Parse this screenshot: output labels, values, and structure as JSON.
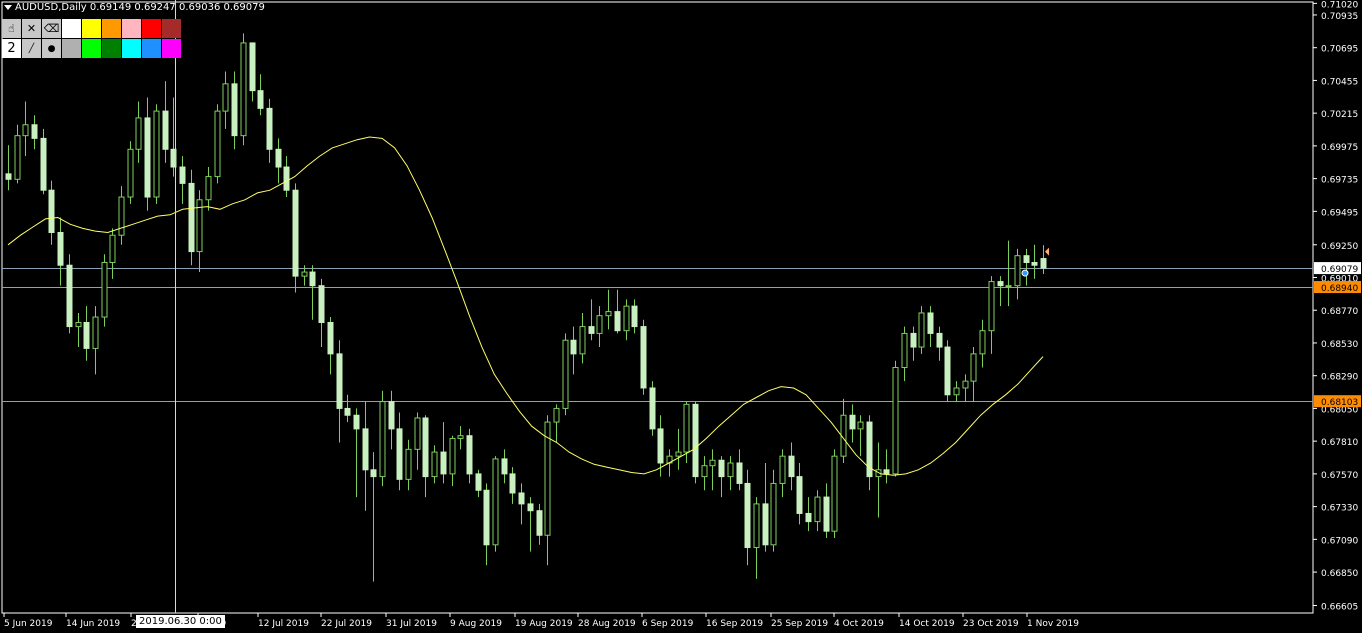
{
  "window": {
    "title": "AUDUSD,Daily  0.69149 0.69247 0.69036 0.69079"
  },
  "toolbar": {
    "tools": [
      "hand-icon",
      "close-x-icon",
      "eraser-icon"
    ],
    "line_width": "2",
    "line_styles": [
      "line-style-icon",
      "dot-style-icon"
    ],
    "colors_row1": [
      "#ffffff",
      "#ffff00",
      "#ff9900",
      "#ffb6c1",
      "#ff0000",
      "#a52a2a"
    ],
    "colors_row2": [
      "#b0b0b0",
      "#00ff00",
      "#008000",
      "#00ffff",
      "#1e90ff",
      "#ff00ff"
    ]
  },
  "crosshair": {
    "date_label": "2019.06.30 0:00"
  },
  "chart_data": {
    "type": "candlestick",
    "symbol": "AUDUSD",
    "timeframe": "Daily",
    "ohlc_header": {
      "open": 0.69149,
      "high": 0.69247,
      "low": 0.69036,
      "close": 0.69079
    },
    "ylim": [
      0.6655,
      0.7103
    ],
    "y_ticks": [
      "0.71020",
      "0.70935",
      "0.70695",
      "0.70455",
      "0.70215",
      "0.69975",
      "0.69735",
      "0.69495",
      "0.69250",
      "0.69010",
      "0.68770",
      "0.68530",
      "0.68290",
      "0.68050",
      "0.67810",
      "0.67570",
      "0.67330",
      "0.67090",
      "0.66850",
      "0.66605"
    ],
    "x_ticks": [
      "5 Jun 2019",
      "14 Jun 2019",
      "2",
      "l 2019",
      "12 Jul 2019",
      "22 Jul 2019",
      "31 Jul 2019",
      "9 Aug 2019",
      "19 Aug 2019",
      "28 Aug 2019",
      "6 Sep 2019",
      "16 Sep 2019",
      "25 Sep 2019",
      "4 Oct 2019",
      "14 Oct 2019",
      "23 Oct 2019",
      "1 Nov 2019"
    ],
    "price_labels": [
      {
        "text": "0.69079",
        "value": 0.69079,
        "color": "#ffffff",
        "bg": "#ffffff"
      },
      {
        "text": "0.68940",
        "value": 0.6894,
        "color": "#000000",
        "bg": "#ff8c00"
      },
      {
        "text": "0.68103",
        "value": 0.68103,
        "color": "#000000",
        "bg": "#ff8c00"
      }
    ],
    "horizontal_lines": [
      {
        "value": 0.69079,
        "color": "#8aa0b8"
      },
      {
        "value": 0.6894,
        "color": "#ff8c00"
      },
      {
        "value": 0.68103,
        "color": "#ff8c00"
      }
    ],
    "candle_color": "#c8f0c0",
    "wick_color": "#7cd05a",
    "ma_color": "#ffff66",
    "candles": [
      [
        0.6977,
        0.6998,
        0.6965,
        0.6973
      ],
      [
        0.6973,
        0.7013,
        0.697,
        0.7005
      ],
      [
        0.7005,
        0.703,
        0.699,
        0.7013
      ],
      [
        0.7013,
        0.702,
        0.6995,
        0.7003
      ],
      [
        0.7003,
        0.701,
        0.6962,
        0.6965
      ],
      [
        0.6965,
        0.6972,
        0.6925,
        0.6934
      ],
      [
        0.6934,
        0.6945,
        0.6895,
        0.691
      ],
      [
        0.691,
        0.6918,
        0.686,
        0.6865
      ],
      [
        0.6865,
        0.6875,
        0.685,
        0.6868
      ],
      [
        0.6868,
        0.688,
        0.684,
        0.6849
      ],
      [
        0.6849,
        0.688,
        0.683,
        0.6872
      ],
      [
        0.6872,
        0.6918,
        0.6865,
        0.6912
      ],
      [
        0.6912,
        0.6937,
        0.69,
        0.6932
      ],
      [
        0.6932,
        0.6968,
        0.6925,
        0.696
      ],
      [
        0.696,
        0.7001,
        0.6955,
        0.6995
      ],
      [
        0.6995,
        0.703,
        0.6985,
        0.7018
      ],
      [
        0.7018,
        0.7033,
        0.695,
        0.696
      ],
      [
        0.696,
        0.7028,
        0.6955,
        0.7023
      ],
      [
        0.7023,
        0.7045,
        0.6985,
        0.6995
      ],
      [
        0.6995,
        0.7033,
        0.6975,
        0.6982
      ],
      [
        0.6982,
        0.699,
        0.6955,
        0.697
      ],
      [
        0.697,
        0.698,
        0.691,
        0.692
      ],
      [
        0.692,
        0.6965,
        0.6905,
        0.6958
      ],
      [
        0.6958,
        0.6982,
        0.695,
        0.6975
      ],
      [
        0.6975,
        0.7028,
        0.697,
        0.7023
      ],
      [
        0.7023,
        0.7052,
        0.701,
        0.7043
      ],
      [
        0.7043,
        0.7052,
        0.6995,
        0.7005
      ],
      [
        0.7005,
        0.708,
        0.6998,
        0.7073
      ],
      [
        0.7073,
        0.7072,
        0.703,
        0.7038
      ],
      [
        0.7038,
        0.705,
        0.702,
        0.7025
      ],
      [
        0.7025,
        0.7032,
        0.6985,
        0.6995
      ],
      [
        0.6995,
        0.7003,
        0.697,
        0.6982
      ],
      [
        0.6982,
        0.699,
        0.696,
        0.6965
      ],
      [
        0.6965,
        0.697,
        0.689,
        0.6902
      ],
      [
        0.6902,
        0.691,
        0.6895,
        0.6905
      ],
      [
        0.6905,
        0.691,
        0.687,
        0.6895
      ],
      [
        0.6895,
        0.69,
        0.685,
        0.6868
      ],
      [
        0.6868,
        0.6872,
        0.683,
        0.6845
      ],
      [
        0.6845,
        0.6855,
        0.678,
        0.6805
      ],
      [
        0.6805,
        0.6815,
        0.6795,
        0.68
      ],
      [
        0.68,
        0.6805,
        0.674,
        0.679
      ],
      [
        0.679,
        0.681,
        0.673,
        0.676
      ],
      [
        0.676,
        0.6773,
        0.6678,
        0.6755
      ],
      [
        0.6755,
        0.6818,
        0.6748,
        0.681
      ],
      [
        0.681,
        0.6818,
        0.6775,
        0.679
      ],
      [
        0.679,
        0.6802,
        0.6745,
        0.6753
      ],
      [
        0.6753,
        0.6782,
        0.6745,
        0.6775
      ],
      [
        0.6775,
        0.6802,
        0.676,
        0.6798
      ],
      [
        0.6798,
        0.68,
        0.674,
        0.6755
      ],
      [
        0.6755,
        0.6778,
        0.675,
        0.6773
      ],
      [
        0.6773,
        0.6795,
        0.675,
        0.6757
      ],
      [
        0.6757,
        0.6785,
        0.6748,
        0.6783
      ],
      [
        0.6783,
        0.6792,
        0.6775,
        0.6785
      ],
      [
        0.6785,
        0.679,
        0.675,
        0.6757
      ],
      [
        0.6757,
        0.676,
        0.674,
        0.6745
      ],
      [
        0.6745,
        0.675,
        0.669,
        0.6705
      ],
      [
        0.6705,
        0.677,
        0.67,
        0.6768
      ],
      [
        0.6768,
        0.6775,
        0.675,
        0.6757
      ],
      [
        0.6757,
        0.6762,
        0.6735,
        0.6743
      ],
      [
        0.6743,
        0.675,
        0.672,
        0.6735
      ],
      [
        0.6735,
        0.674,
        0.67,
        0.673
      ],
      [
        0.673,
        0.6735,
        0.6705,
        0.6712
      ],
      [
        0.6712,
        0.68,
        0.669,
        0.6795
      ],
      [
        0.6795,
        0.6808,
        0.678,
        0.6805
      ],
      [
        0.6805,
        0.686,
        0.68,
        0.6855
      ],
      [
        0.6855,
        0.6865,
        0.683,
        0.6845
      ],
      [
        0.6845,
        0.6875,
        0.6838,
        0.6865
      ],
      [
        0.6865,
        0.6885,
        0.6855,
        0.686
      ],
      [
        0.686,
        0.688,
        0.685,
        0.6873
      ],
      [
        0.6873,
        0.6892,
        0.6863,
        0.6876
      ],
      [
        0.6876,
        0.6892,
        0.686,
        0.6862
      ],
      [
        0.6862,
        0.6885,
        0.6855,
        0.688
      ],
      [
        0.688,
        0.6885,
        0.686,
        0.6865
      ],
      [
        0.6865,
        0.687,
        0.6815,
        0.682
      ],
      [
        0.682,
        0.6825,
        0.6785,
        0.679
      ],
      [
        0.679,
        0.68,
        0.6755,
        0.6765
      ],
      [
        0.6765,
        0.6775,
        0.6755,
        0.677
      ],
      [
        0.677,
        0.679,
        0.676,
        0.6773
      ],
      [
        0.6773,
        0.681,
        0.6765,
        0.6808
      ],
      [
        0.6808,
        0.681,
        0.675,
        0.6755
      ],
      [
        0.6755,
        0.677,
        0.6745,
        0.6763
      ],
      [
        0.6763,
        0.6775,
        0.6745,
        0.6767
      ],
      [
        0.6767,
        0.677,
        0.674,
        0.6755
      ],
      [
        0.6755,
        0.677,
        0.6745,
        0.6765
      ],
      [
        0.6765,
        0.6775,
        0.6745,
        0.675
      ],
      [
        0.675,
        0.676,
        0.669,
        0.6703
      ],
      [
        0.6703,
        0.674,
        0.668,
        0.6735
      ],
      [
        0.6735,
        0.6765,
        0.67,
        0.6705
      ],
      [
        0.6705,
        0.676,
        0.67,
        0.675
      ],
      [
        0.675,
        0.6775,
        0.674,
        0.677
      ],
      [
        0.677,
        0.678,
        0.6745,
        0.6755
      ],
      [
        0.6755,
        0.6765,
        0.672,
        0.6728
      ],
      [
        0.6728,
        0.674,
        0.6715,
        0.6722
      ],
      [
        0.6722,
        0.6745,
        0.6715,
        0.674
      ],
      [
        0.674,
        0.675,
        0.671,
        0.6715
      ],
      [
        0.6715,
        0.6775,
        0.671,
        0.677
      ],
      [
        0.677,
        0.6812,
        0.6765,
        0.68
      ],
      [
        0.68,
        0.6808,
        0.678,
        0.679
      ],
      [
        0.679,
        0.68,
        0.677,
        0.6795
      ],
      [
        0.6795,
        0.68,
        0.6745,
        0.6755
      ],
      [
        0.6755,
        0.678,
        0.6725,
        0.676
      ],
      [
        0.676,
        0.6775,
        0.675,
        0.6757
      ],
      [
        0.6757,
        0.684,
        0.6755,
        0.6835
      ],
      [
        0.6835,
        0.6865,
        0.6825,
        0.686
      ],
      [
        0.686,
        0.6865,
        0.684,
        0.685
      ],
      [
        0.685,
        0.688,
        0.6845,
        0.6875
      ],
      [
        0.6875,
        0.688,
        0.685,
        0.686
      ],
      [
        0.686,
        0.6865,
        0.684,
        0.685
      ],
      [
        0.685,
        0.6855,
        0.681,
        0.6815
      ],
      [
        0.6815,
        0.6825,
        0.681,
        0.682
      ],
      [
        0.682,
        0.683,
        0.681,
        0.6825
      ],
      [
        0.6825,
        0.685,
        0.681,
        0.6845
      ],
      [
        0.6845,
        0.687,
        0.6835,
        0.6862
      ],
      [
        0.6862,
        0.6902,
        0.6845,
        0.6898
      ],
      [
        0.6898,
        0.6902,
        0.688,
        0.6895
      ],
      [
        0.6895,
        0.6928,
        0.688,
        0.6895
      ],
      [
        0.6895,
        0.6922,
        0.6885,
        0.6917
      ],
      [
        0.6917,
        0.6922,
        0.6895,
        0.6912
      ],
      [
        0.6912,
        0.6925,
        0.69,
        0.691
      ],
      [
        0.69149,
        0.69247,
        0.69036,
        0.69079
      ]
    ],
    "ma": [
      0.6925,
      0.6932,
      0.6938,
      0.6944,
      0.6945,
      0.694,
      0.6937,
      0.6935,
      0.6934,
      0.6937,
      0.694,
      0.6943,
      0.6946,
      0.6947,
      0.6951,
      0.6952,
      0.6953,
      0.6951,
      0.6955,
      0.6958,
      0.6963,
      0.6965,
      0.697,
      0.6975,
      0.6983,
      0.699,
      0.6996,
      0.6999,
      0.7002,
      0.7004,
      0.7003,
      0.6996,
      0.6983,
      0.6965,
      0.6945,
      0.6922,
      0.6898,
      0.6873,
      0.685,
      0.683,
      0.6816,
      0.6803,
      0.6792,
      0.6785,
      0.678,
      0.6773,
      0.6768,
      0.6764,
      0.6762,
      0.676,
      0.6758,
      0.6757,
      0.676,
      0.6765,
      0.677,
      0.6775,
      0.6783,
      0.6792,
      0.68,
      0.6808,
      0.6813,
      0.6818,
      0.6821,
      0.682,
      0.6815,
      0.6805,
      0.6795,
      0.6783,
      0.6771,
      0.6762,
      0.6757,
      0.6756,
      0.6757,
      0.676,
      0.6765,
      0.6772,
      0.678,
      0.679,
      0.68,
      0.6808,
      0.6815,
      0.6823,
      0.6833,
      0.6843
    ],
    "ma_start_index": 0
  }
}
